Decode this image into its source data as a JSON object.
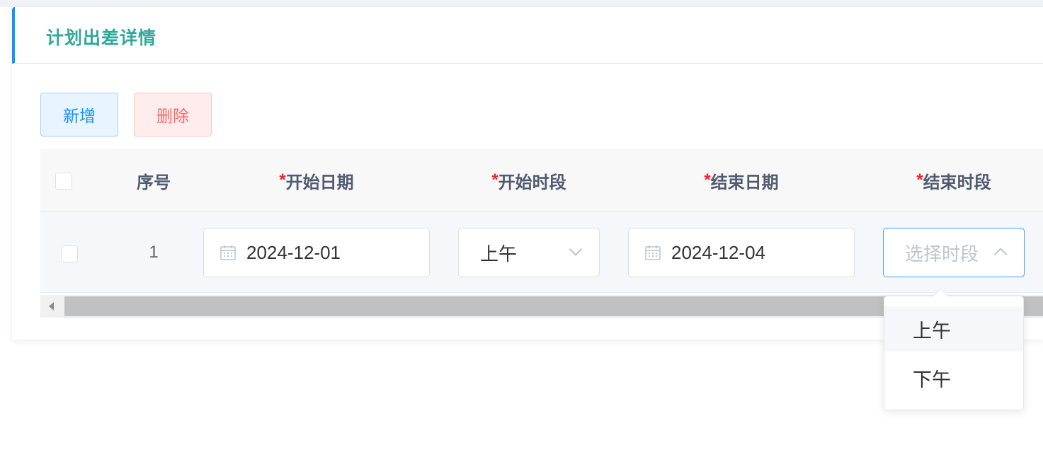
{
  "card": {
    "title": "计划出差详情"
  },
  "toolbar": {
    "add_label": "新增",
    "delete_label": "删除"
  },
  "table": {
    "columns": {
      "index": "序号",
      "start_date": "开始日期",
      "start_period": "开始时段",
      "end_date": "结束日期",
      "end_period": "结束时段",
      "required_mark": "*"
    },
    "rows": [
      {
        "index": "1",
        "start_date": "2024-12-01",
        "start_period": "上午",
        "end_date": "2024-12-04",
        "end_period_placeholder": "选择时段"
      }
    ]
  },
  "dropdown": {
    "options": [
      "上午",
      "下午"
    ]
  },
  "colors": {
    "title": "#2fa89a",
    "accent": "#1890ff",
    "danger": "#f56c6c",
    "required": "#f5222d"
  }
}
